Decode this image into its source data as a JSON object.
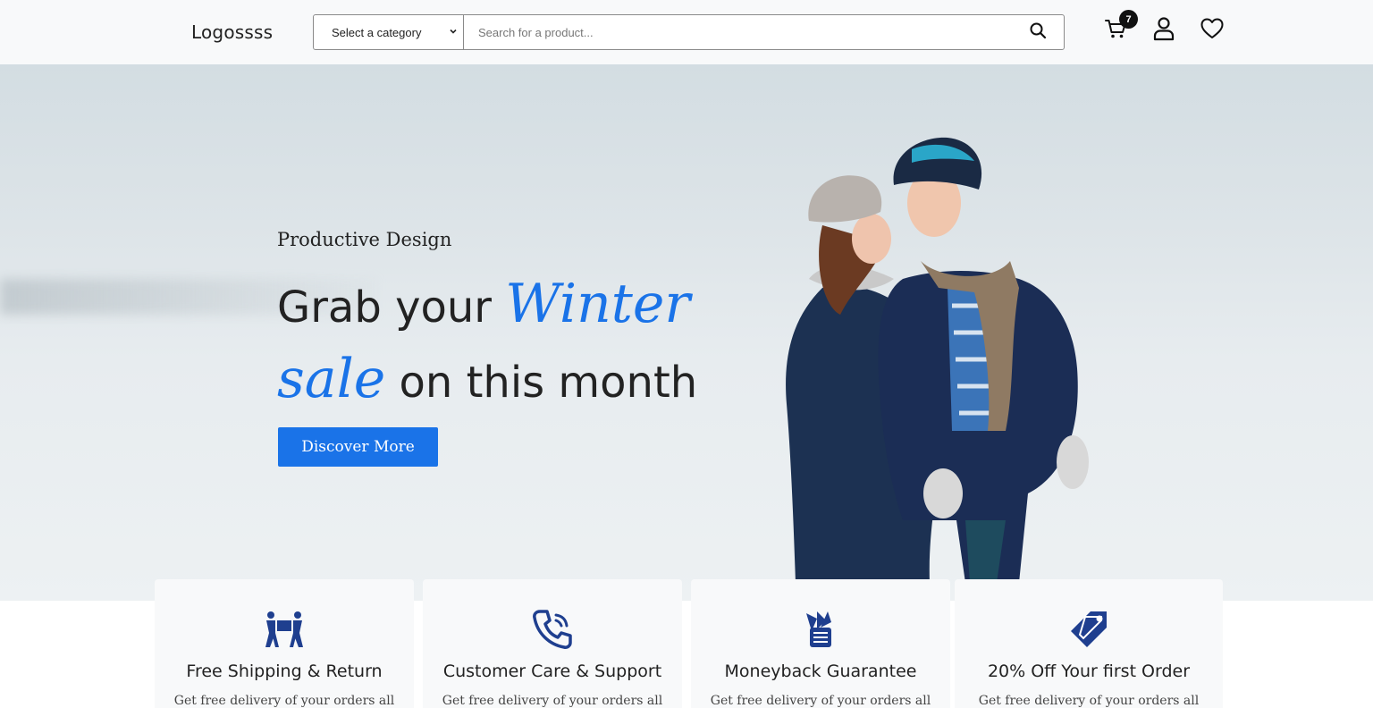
{
  "header": {
    "logo": "Logossss",
    "category_select": {
      "selected": "Select a category"
    },
    "search": {
      "placeholder": "Search for a product..."
    },
    "cart_count": "7",
    "icons": [
      "search-icon",
      "cart-icon",
      "user-icon",
      "heart-icon"
    ]
  },
  "hero": {
    "subtitle": "Productive Design",
    "title_part1": "Grab your",
    "title_accent1": "Winter",
    "title_accent2": "sale",
    "title_part2": "on this month",
    "cta_label": "Discover More"
  },
  "features": [
    {
      "icon": "shipping-icon",
      "title": "Free Shipping & Return",
      "desc": "Get free delivery of your orders all"
    },
    {
      "icon": "phone-icon",
      "title": "Customer Care & Support",
      "desc": "Get free delivery of your orders all"
    },
    {
      "icon": "money-icon",
      "title": "Moneyback Guarantee",
      "desc": "Get free delivery of your orders all"
    },
    {
      "icon": "tag-icon",
      "title": "20% Off Your first Order",
      "desc": "Get free delivery of your orders all"
    }
  ],
  "colors": {
    "accent": "#1a73e8",
    "icon_blue": "#1f3f8f",
    "header_bg": "#f8f9fa"
  }
}
